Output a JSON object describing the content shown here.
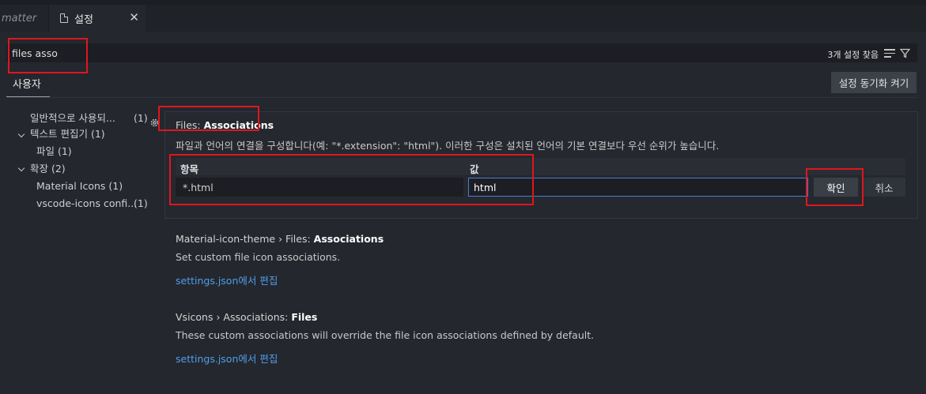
{
  "tabs": {
    "prev_label": "matter",
    "active_label": "설정",
    "close_glyph": "✕"
  },
  "search": {
    "value": "files asso",
    "result_count": "3개 설정 찾음"
  },
  "scope": {
    "user_tab": "사용자",
    "sync_button": "설정 동기화 켜기"
  },
  "toc": {
    "commonly_used": "일반적으로 사용되...",
    "commonly_used_count": "(1)",
    "text_editor": "텍스트 편집기 (1)",
    "files": "파일 (1)",
    "extensions": "확장 (2)",
    "material_icons": "Material Icons (1)",
    "vscode_icons": "vscode-icons confi...",
    "vscode_icons_count": "(1)"
  },
  "setting1": {
    "title_prefix": "Files: ",
    "title_name": "Associations",
    "description": "파일과 언어의 연결을 구성합니다(예: \"*.extension\": \"html\"). 이러한 구성은 설치된 언어의 기본 연결보다 우선 순위가 높습니다.",
    "col_item": "항목",
    "col_value": "값",
    "key_value": "*.html",
    "value_value": "html",
    "ok_label": "확인",
    "cancel_label": "취소"
  },
  "setting2": {
    "title_prefix": "Material-icon-theme › Files: ",
    "title_name": "Associations",
    "description": "Set custom file icon associations.",
    "link": "settings.json에서 편집"
  },
  "setting3": {
    "title_prefix": "Vsicons › Associations: ",
    "title_name": "Files",
    "description": "These custom associations will override the file icon associations defined by default.",
    "link": "settings.json에서 편집"
  },
  "colors": {
    "background": "#24272e",
    "link": "#4f9fe8",
    "focus_border": "#4b7fd1",
    "annotation_red": "#e0161d"
  },
  "icons": [
    "file-icon",
    "close-icon",
    "clear-filter-icon",
    "filter-icon",
    "gear-icon",
    "chevron-down-icon"
  ]
}
